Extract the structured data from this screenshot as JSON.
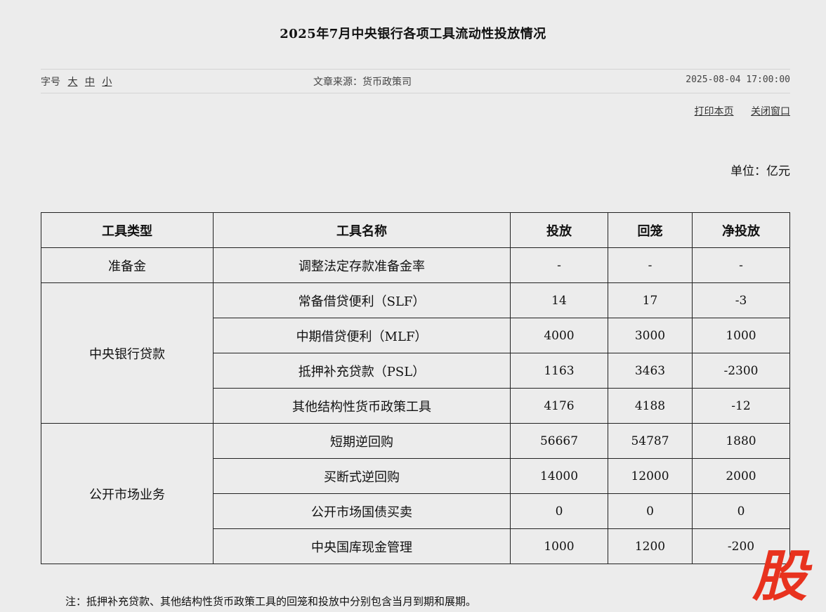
{
  "title": "2025年7月中央银行各项工具流动性投放情况",
  "meta": {
    "font_size_label": "字号",
    "font_sizes": [
      "大",
      "中",
      "小"
    ],
    "source": "文章来源：货币政策司",
    "date": "2025-08-04 17:00:00"
  },
  "actions": {
    "print": "打印本页",
    "close": "关闭窗口"
  },
  "unit": "单位：亿元",
  "table": {
    "headers": [
      "工具类型",
      "工具名称",
      "投放",
      "回笼",
      "净投放"
    ],
    "groups": [
      {
        "type": "准备金",
        "rows": [
          {
            "name": "调整法定存款准备金率",
            "inject": "-",
            "withdraw": "-",
            "net": "-"
          }
        ]
      },
      {
        "type": "中央银行贷款",
        "rows": [
          {
            "name": "常备借贷便利（SLF）",
            "inject": "14",
            "withdraw": "17",
            "net": "-3"
          },
          {
            "name": "中期借贷便利（MLF）",
            "inject": "4000",
            "withdraw": "3000",
            "net": "1000"
          },
          {
            "name": "抵押补充贷款（PSL）",
            "inject": "1163",
            "withdraw": "3463",
            "net": "-2300"
          },
          {
            "name": "其他结构性货币政策工具",
            "inject": "4176",
            "withdraw": "4188",
            "net": "-12"
          }
        ]
      },
      {
        "type": "公开市场业务",
        "rows": [
          {
            "name": "短期逆回购",
            "inject": "56667",
            "withdraw": "54787",
            "net": "1880"
          },
          {
            "name": "买断式逆回购",
            "inject": "14000",
            "withdraw": "12000",
            "net": "2000"
          },
          {
            "name": "公开市场国债买卖",
            "inject": "0",
            "withdraw": "0",
            "net": "0"
          },
          {
            "name": "中央国库现金管理",
            "inject": "1000",
            "withdraw": "1200",
            "net": "-200"
          }
        ]
      }
    ]
  },
  "note": "注：抵押补充贷款、其他结构性货币政策工具的回笼和投放中分别包含当月到期和展期。",
  "logo": {
    "icon": "stock-logo-icon",
    "glyph": "股",
    "color": "#e8321e"
  }
}
